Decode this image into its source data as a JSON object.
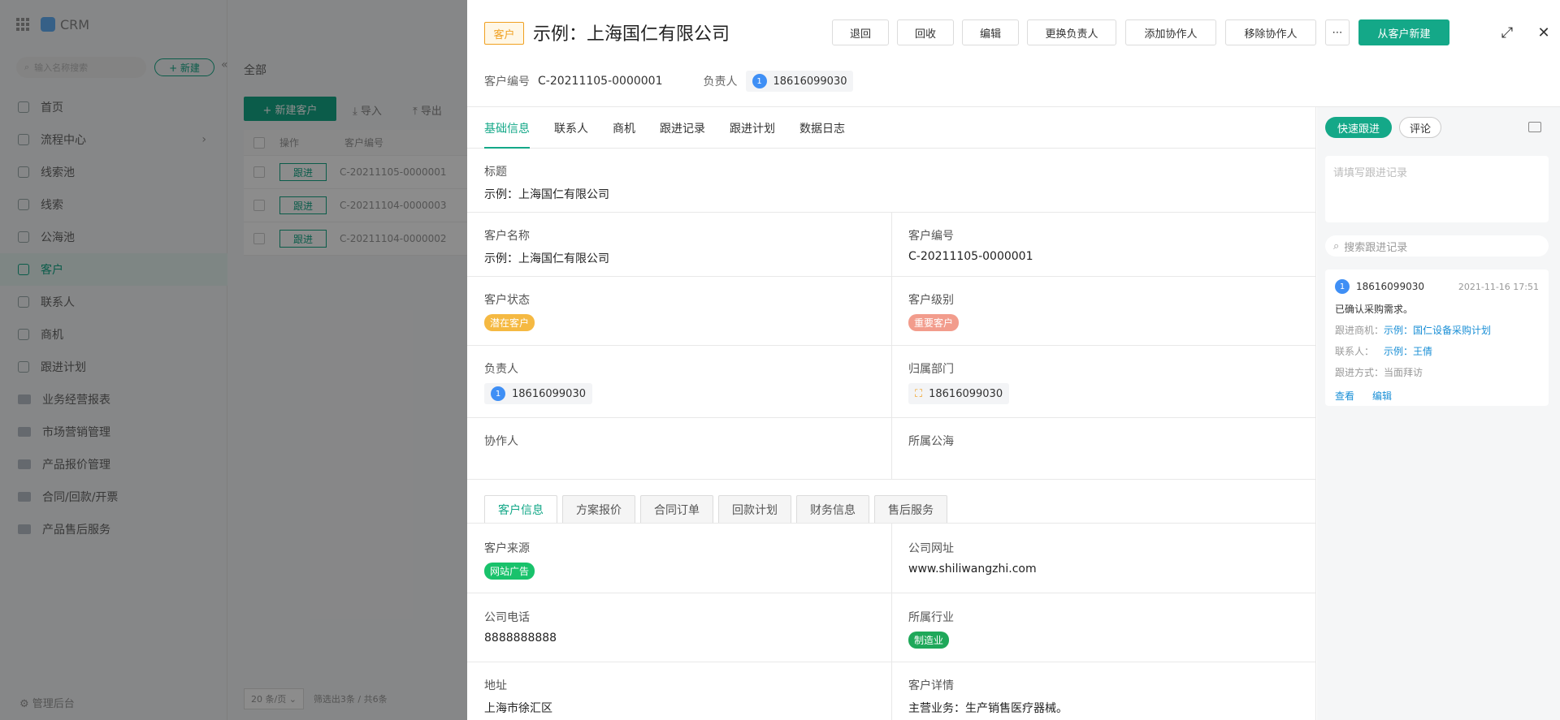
{
  "background": {
    "app_name": "CRM",
    "search_placeholder": "输入名称搜索",
    "new_label": "+ 新建",
    "nav": [
      {
        "label": "首页",
        "icon": "home-icon"
      },
      {
        "label": "流程中心",
        "icon": "flow-icon"
      },
      {
        "label": "线索池",
        "icon": "pool-icon"
      },
      {
        "label": "线索",
        "icon": "lead-icon"
      },
      {
        "label": "公海池",
        "icon": "sea-icon"
      },
      {
        "label": "客户",
        "icon": "customer-icon"
      },
      {
        "label": "联系人",
        "icon": "contact-icon"
      },
      {
        "label": "商机",
        "icon": "opportunity-icon"
      },
      {
        "label": "跟进计划",
        "icon": "plan-icon"
      },
      {
        "label": "业务经营报表",
        "icon": "folder-icon"
      },
      {
        "label": "市场营销管理",
        "icon": "folder-icon"
      },
      {
        "label": "产品报价管理",
        "icon": "folder-icon"
      },
      {
        "label": "合同/回款/开票",
        "icon": "folder-icon"
      },
      {
        "label": "产品售后服务",
        "icon": "folder-icon"
      }
    ],
    "admin": "管理后台",
    "crumb": "全部",
    "new_customer": "+ 新建客户",
    "import": "导入",
    "export": "导出",
    "table_headers": [
      "操作",
      "客户编号"
    ],
    "rows": [
      {
        "action": "跟进",
        "code": "C-20211105-0000001"
      },
      {
        "action": "跟进",
        "code": "C-20211104-0000003"
      },
      {
        "action": "跟进",
        "code": "C-20211104-0000002"
      }
    ],
    "page_size": "20 条/页",
    "filter_info": "筛选出3条 / 共6条"
  },
  "header": {
    "type_tag": "客户",
    "title": "示例：上海国仁有限公司",
    "actions": [
      "退回",
      "回收",
      "编辑",
      "更换负责人",
      "添加协作人",
      "移除协作人",
      "⋯",
      "从客户新建"
    ],
    "code_label": "客户编号",
    "code_value": "C-20211105-0000001",
    "owner_label": "负责人",
    "owner_avatar": "1",
    "owner_value": "18616099030"
  },
  "tabs": [
    "基础信息",
    "联系人",
    "商机",
    "跟进记录",
    "跟进计划",
    "数据日志"
  ],
  "fields": {
    "title_label": "标题",
    "title_value": "示例：上海国仁有限公司",
    "name_label": "客户名称",
    "name_value": "示例：上海国仁有限公司",
    "code_label": "客户编号",
    "code_value": "C-20211105-0000001",
    "status_label": "客户状态",
    "status_value": "潜在客户",
    "status_color": "#f5b942",
    "level_label": "客户级别",
    "level_value": "重要客户",
    "level_color": "#f29c8c",
    "owner_label": "负责人",
    "owner_avatar": "1",
    "owner_value": "18616099030",
    "dept_label": "归属部门",
    "dept_value": "18616099030",
    "collab_label": "协作人",
    "sea_label": "所属公海"
  },
  "subtabs": [
    "客户信息",
    "方案报价",
    "合同订单",
    "回款计划",
    "财务信息",
    "售后服务"
  ],
  "info": {
    "source_label": "客户来源",
    "source_value": "网站广告",
    "source_color": "#19c26b",
    "website_label": "公司网址",
    "website_value": "www.shiliwangzhi.com",
    "phone_label": "公司电话",
    "phone_value": "8888888888",
    "industry_label": "所属行业",
    "industry_value": "制造业",
    "industry_color": "#1fa85a",
    "address_label": "地址",
    "address_value": "上海市徐汇区",
    "detail_label": "客户详情",
    "detail_value": "主营业务：生产销售医疗器械。"
  },
  "right_panel": {
    "quick_follow": "快速跟进",
    "comment": "评论",
    "textarea_placeholder": "请填写跟进记录",
    "search_placeholder": "搜索跟进记录",
    "record": {
      "avatar": "1",
      "user": "18616099030",
      "time": "2021-11-16 17:51",
      "content": "已确认采购需求。",
      "opp_label": "跟进商机：",
      "opp_value": "示例：国仁设备采购计划",
      "contact_label": "联系人：",
      "contact_value": "示例：王倩",
      "method_label": "跟进方式：",
      "method_value": "当面拜访",
      "view": "查看",
      "edit": "编辑"
    }
  },
  "colors": {
    "accent": "#14a888",
    "link": "#1a8fd6"
  }
}
